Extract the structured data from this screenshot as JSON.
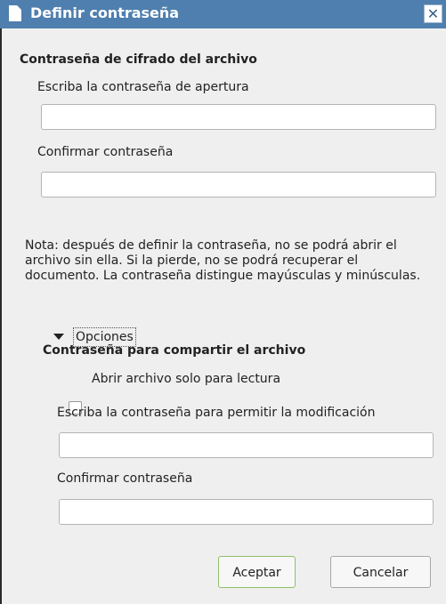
{
  "window": {
    "title": "Definir contraseña",
    "close_glyph": "✕"
  },
  "encryption": {
    "section_title": "Contraseña de cifrado del archivo",
    "open_password_label": "Escriba la contraseña de apertura",
    "open_password_value": "",
    "confirm_label": "Confirmar contraseña",
    "confirm_value": "",
    "note": "Nota: después de definir la contraseña, no se podrá abrir el archivo sin ella. Si la pierde, no se podrá recuperar el documento. La contraseña distingue mayúsculas y minúsculas."
  },
  "options": {
    "expander_label": "Opciones",
    "expanded": true
  },
  "sharing": {
    "section_title": "Contraseña para compartir el archivo",
    "readonly_label": "Abrir archivo solo para lectura",
    "readonly_checked": false,
    "modify_password_label": "Escriba la contraseña para permitir la modificación",
    "modify_password_value": "",
    "confirm_label": "Confirmar contraseña",
    "confirm_value": ""
  },
  "buttons": {
    "ok_label": "Aceptar",
    "cancel_label": "Cancelar"
  },
  "colors": {
    "titlebar": "#4e7fae",
    "dialog_bg": "#efefef",
    "ok_border": "#8fbf6a"
  },
  "icons": {
    "title_icon": "document-icon",
    "close_icon": "close-icon",
    "expander_icon": "triangle-down-icon"
  }
}
